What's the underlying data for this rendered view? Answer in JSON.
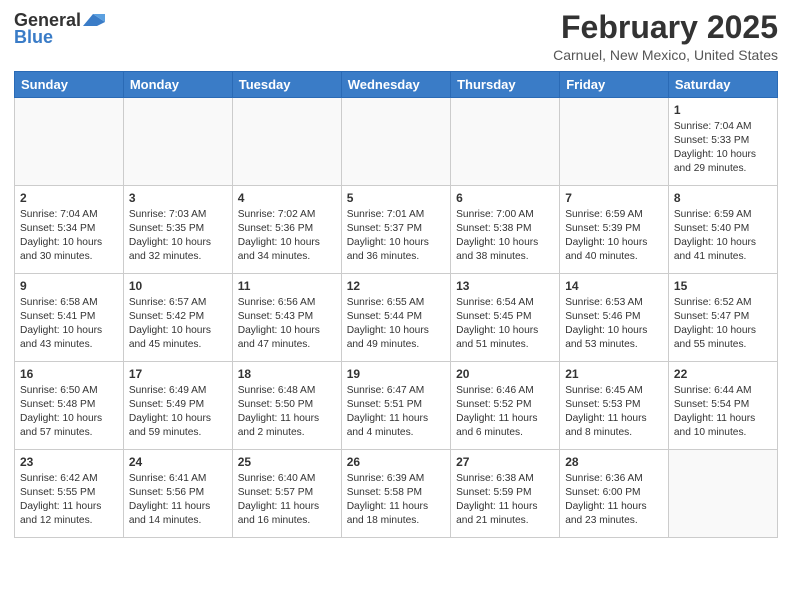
{
  "header": {
    "logo_general": "General",
    "logo_blue": "Blue",
    "month_title": "February 2025",
    "location": "Carnuel, New Mexico, United States"
  },
  "weekdays": [
    "Sunday",
    "Monday",
    "Tuesday",
    "Wednesday",
    "Thursday",
    "Friday",
    "Saturday"
  ],
  "weeks": [
    [
      {
        "day": "",
        "info": ""
      },
      {
        "day": "",
        "info": ""
      },
      {
        "day": "",
        "info": ""
      },
      {
        "day": "",
        "info": ""
      },
      {
        "day": "",
        "info": ""
      },
      {
        "day": "",
        "info": ""
      },
      {
        "day": "1",
        "info": "Sunrise: 7:04 AM\nSunset: 5:33 PM\nDaylight: 10 hours\nand 29 minutes."
      }
    ],
    [
      {
        "day": "2",
        "info": "Sunrise: 7:04 AM\nSunset: 5:34 PM\nDaylight: 10 hours\nand 30 minutes."
      },
      {
        "day": "3",
        "info": "Sunrise: 7:03 AM\nSunset: 5:35 PM\nDaylight: 10 hours\nand 32 minutes."
      },
      {
        "day": "4",
        "info": "Sunrise: 7:02 AM\nSunset: 5:36 PM\nDaylight: 10 hours\nand 34 minutes."
      },
      {
        "day": "5",
        "info": "Sunrise: 7:01 AM\nSunset: 5:37 PM\nDaylight: 10 hours\nand 36 minutes."
      },
      {
        "day": "6",
        "info": "Sunrise: 7:00 AM\nSunset: 5:38 PM\nDaylight: 10 hours\nand 38 minutes."
      },
      {
        "day": "7",
        "info": "Sunrise: 6:59 AM\nSunset: 5:39 PM\nDaylight: 10 hours\nand 40 minutes."
      },
      {
        "day": "8",
        "info": "Sunrise: 6:59 AM\nSunset: 5:40 PM\nDaylight: 10 hours\nand 41 minutes."
      }
    ],
    [
      {
        "day": "9",
        "info": "Sunrise: 6:58 AM\nSunset: 5:41 PM\nDaylight: 10 hours\nand 43 minutes."
      },
      {
        "day": "10",
        "info": "Sunrise: 6:57 AM\nSunset: 5:42 PM\nDaylight: 10 hours\nand 45 minutes."
      },
      {
        "day": "11",
        "info": "Sunrise: 6:56 AM\nSunset: 5:43 PM\nDaylight: 10 hours\nand 47 minutes."
      },
      {
        "day": "12",
        "info": "Sunrise: 6:55 AM\nSunset: 5:44 PM\nDaylight: 10 hours\nand 49 minutes."
      },
      {
        "day": "13",
        "info": "Sunrise: 6:54 AM\nSunset: 5:45 PM\nDaylight: 10 hours\nand 51 minutes."
      },
      {
        "day": "14",
        "info": "Sunrise: 6:53 AM\nSunset: 5:46 PM\nDaylight: 10 hours\nand 53 minutes."
      },
      {
        "day": "15",
        "info": "Sunrise: 6:52 AM\nSunset: 5:47 PM\nDaylight: 10 hours\nand 55 minutes."
      }
    ],
    [
      {
        "day": "16",
        "info": "Sunrise: 6:50 AM\nSunset: 5:48 PM\nDaylight: 10 hours\nand 57 minutes."
      },
      {
        "day": "17",
        "info": "Sunrise: 6:49 AM\nSunset: 5:49 PM\nDaylight: 10 hours\nand 59 minutes."
      },
      {
        "day": "18",
        "info": "Sunrise: 6:48 AM\nSunset: 5:50 PM\nDaylight: 11 hours\nand 2 minutes."
      },
      {
        "day": "19",
        "info": "Sunrise: 6:47 AM\nSunset: 5:51 PM\nDaylight: 11 hours\nand 4 minutes."
      },
      {
        "day": "20",
        "info": "Sunrise: 6:46 AM\nSunset: 5:52 PM\nDaylight: 11 hours\nand 6 minutes."
      },
      {
        "day": "21",
        "info": "Sunrise: 6:45 AM\nSunset: 5:53 PM\nDaylight: 11 hours\nand 8 minutes."
      },
      {
        "day": "22",
        "info": "Sunrise: 6:44 AM\nSunset: 5:54 PM\nDaylight: 11 hours\nand 10 minutes."
      }
    ],
    [
      {
        "day": "23",
        "info": "Sunrise: 6:42 AM\nSunset: 5:55 PM\nDaylight: 11 hours\nand 12 minutes."
      },
      {
        "day": "24",
        "info": "Sunrise: 6:41 AM\nSunset: 5:56 PM\nDaylight: 11 hours\nand 14 minutes."
      },
      {
        "day": "25",
        "info": "Sunrise: 6:40 AM\nSunset: 5:57 PM\nDaylight: 11 hours\nand 16 minutes."
      },
      {
        "day": "26",
        "info": "Sunrise: 6:39 AM\nSunset: 5:58 PM\nDaylight: 11 hours\nand 18 minutes."
      },
      {
        "day": "27",
        "info": "Sunrise: 6:38 AM\nSunset: 5:59 PM\nDaylight: 11 hours\nand 21 minutes."
      },
      {
        "day": "28",
        "info": "Sunrise: 6:36 AM\nSunset: 6:00 PM\nDaylight: 11 hours\nand 23 minutes."
      },
      {
        "day": "",
        "info": ""
      }
    ]
  ]
}
